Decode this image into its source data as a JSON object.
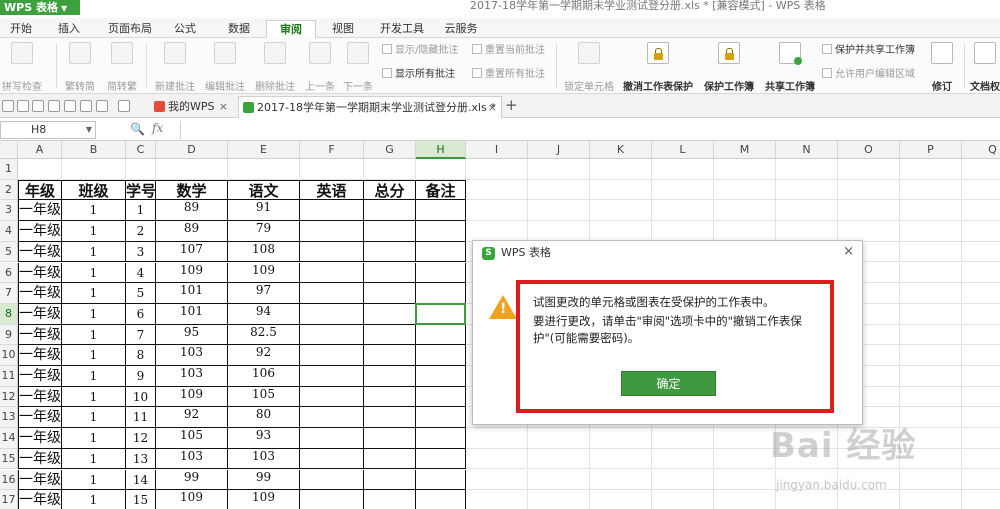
{
  "window": {
    "app_name": "WPS 表格",
    "doc_title": "2017-18学年第一学期期末学业测试登分册.xls * [兼容模式] - WPS 表格"
  },
  "menu_tabs": [
    "开始",
    "插入",
    "页面布局",
    "公式",
    "数据",
    "审阅",
    "视图",
    "开发工具",
    "云服务"
  ],
  "active_menu_tab": "审阅",
  "ribbon": {
    "spellcheck": "拼写检查",
    "trad_to_simp": "繁转简",
    "simp_to_trad": "简转繁",
    "new_comment": "新建批注",
    "edit_comment": "编辑批注",
    "delete_comment": "删除批注",
    "prev": "上一条",
    "next": "下一条",
    "show_hide_comment": "显示/隐藏批注",
    "reset_current_comment": "重置当前批注",
    "show_all_comments": "显示所有批注",
    "reset_all_comments": "重置所有批注",
    "lock_cell": "锁定单元格",
    "unprotect_sheet": "撤消工作表保护",
    "protect_workbook": "保护工作簿",
    "share_workbook": "共享工作簿",
    "protect_and_share": "保护并共享工作簿",
    "allow_users_edit": "允许用户编辑区域",
    "track_changes": "修订",
    "document_right": "文档权"
  },
  "doc_tabs": [
    {
      "label": "我的WPS",
      "icon_color": "#e64a3b"
    },
    {
      "label": "2017-18学年第一学期期末学业测试登分册.xls *",
      "icon_color": "#3aa53a"
    }
  ],
  "formula_bar": {
    "name_box": "H8",
    "fx": "fx",
    "content": ""
  },
  "grid": {
    "columns": [
      "A",
      "B",
      "C",
      "D",
      "E",
      "F",
      "G",
      "H",
      "I",
      "J",
      "K",
      "L",
      "M",
      "N",
      "O",
      "P",
      "Q"
    ],
    "selected_column": "H",
    "selected_row": 8,
    "row_numbers": [
      1,
      2,
      3,
      4,
      5,
      6,
      7,
      8,
      9,
      10,
      11,
      12,
      13,
      14,
      15,
      16,
      17
    ],
    "header_row": [
      "年级",
      "班级",
      "学号",
      "数学",
      "语文",
      "英语",
      "总分",
      "备注"
    ],
    "rows": [
      [
        "一年级",
        "1",
        "1",
        "89",
        "91"
      ],
      [
        "一年级",
        "1",
        "2",
        "89",
        "79"
      ],
      [
        "一年级",
        "1",
        "3",
        "107",
        "108"
      ],
      [
        "一年级",
        "1",
        "4",
        "109",
        "109"
      ],
      [
        "一年级",
        "1",
        "5",
        "101",
        "97"
      ],
      [
        "一年级",
        "1",
        "6",
        "101",
        "94"
      ],
      [
        "一年级",
        "1",
        "7",
        "95",
        "82.5"
      ],
      [
        "一年级",
        "1",
        "8",
        "103",
        "92"
      ],
      [
        "一年级",
        "1",
        "9",
        "103",
        "106"
      ],
      [
        "一年级",
        "1",
        "10",
        "109",
        "105"
      ],
      [
        "一年级",
        "1",
        "11",
        "92",
        "80"
      ],
      [
        "一年级",
        "1",
        "12",
        "105",
        "93"
      ],
      [
        "一年级",
        "1",
        "13",
        "103",
        "103"
      ],
      [
        "一年级",
        "1",
        "14",
        "99",
        "99"
      ],
      [
        "一年级",
        "1",
        "15",
        "109",
        "109"
      ]
    ]
  },
  "dialog": {
    "title": "WPS 表格",
    "close": "×",
    "message_line1": "试图更改的单元格或图表在受保护的工作表中。",
    "message_line2": "要进行更改，请单击\"审阅\"选项卡中的\"撤销工作表保护\"(可能需要密码)。",
    "ok_label": "确定",
    "highlight_color": "#e31a1a"
  },
  "watermark": {
    "text": "Bai 经验",
    "url": "jingyan.baidu.com"
  },
  "colors": {
    "accent": "#3f9a3f",
    "warning": "#f0a21f"
  }
}
